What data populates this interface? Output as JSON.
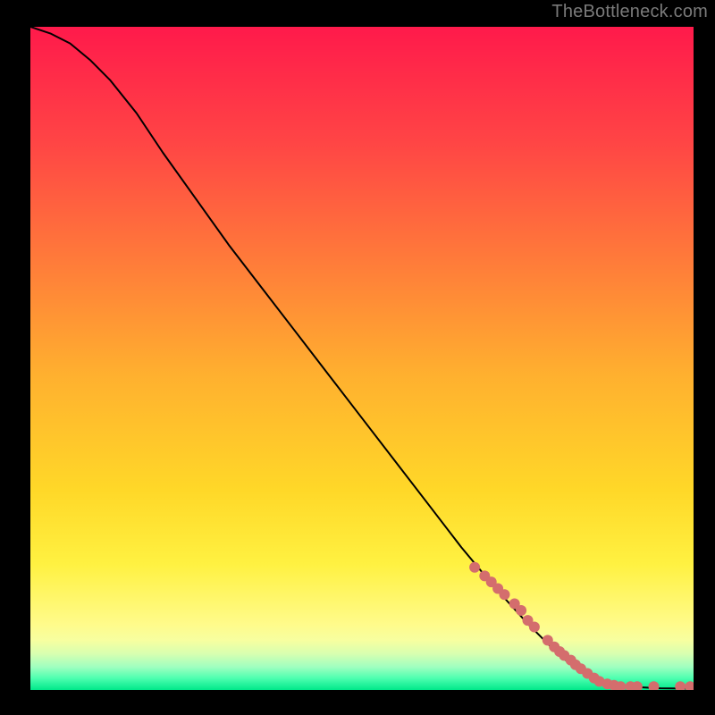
{
  "watermark": "TheBottleneck.com",
  "chart_data": {
    "type": "line",
    "title": "",
    "xlabel": "",
    "ylabel": "",
    "xlim": [
      0,
      100
    ],
    "ylim": [
      0,
      100
    ],
    "x_ticks": [],
    "y_ticks": [],
    "grid": false,
    "legend": false,
    "background": "rainbow-gradient",
    "series": [
      {
        "name": "curve",
        "x": [
          0,
          3,
          6,
          9,
          12,
          16,
          20,
          25,
          30,
          35,
          40,
          45,
          50,
          55,
          60,
          65,
          70,
          75,
          80,
          84,
          86,
          88,
          90,
          92,
          95,
          100
        ],
        "y": [
          100,
          99,
          97.5,
          95,
          92,
          87,
          81,
          74,
          67,
          60.5,
          54,
          47.5,
          41,
          34.5,
          28,
          21.5,
          15.5,
          10,
          5,
          2.2,
          1.4,
          0.9,
          0.6,
          0.4,
          0.25,
          0.2
        ]
      }
    ],
    "points": {
      "name": "markers",
      "color": "#d46d6d",
      "size": 6,
      "x": [
        67,
        68.5,
        69.5,
        70.5,
        71.5,
        73,
        74,
        75,
        76,
        78,
        79,
        79.8,
        80.5,
        81.5,
        82.2,
        83,
        84,
        85,
        85.8,
        87,
        88,
        89,
        90.5,
        91.5,
        94,
        98,
        99.5
      ],
      "y": [
        18.5,
        17.2,
        16.3,
        15.3,
        14.4,
        13,
        12,
        10.5,
        9.5,
        7.5,
        6.5,
        5.8,
        5.2,
        4.5,
        3.8,
        3.2,
        2.5,
        1.8,
        1.3,
        0.9,
        0.7,
        0.5,
        0.5,
        0.5,
        0.5,
        0.5,
        0.5
      ]
    }
  }
}
